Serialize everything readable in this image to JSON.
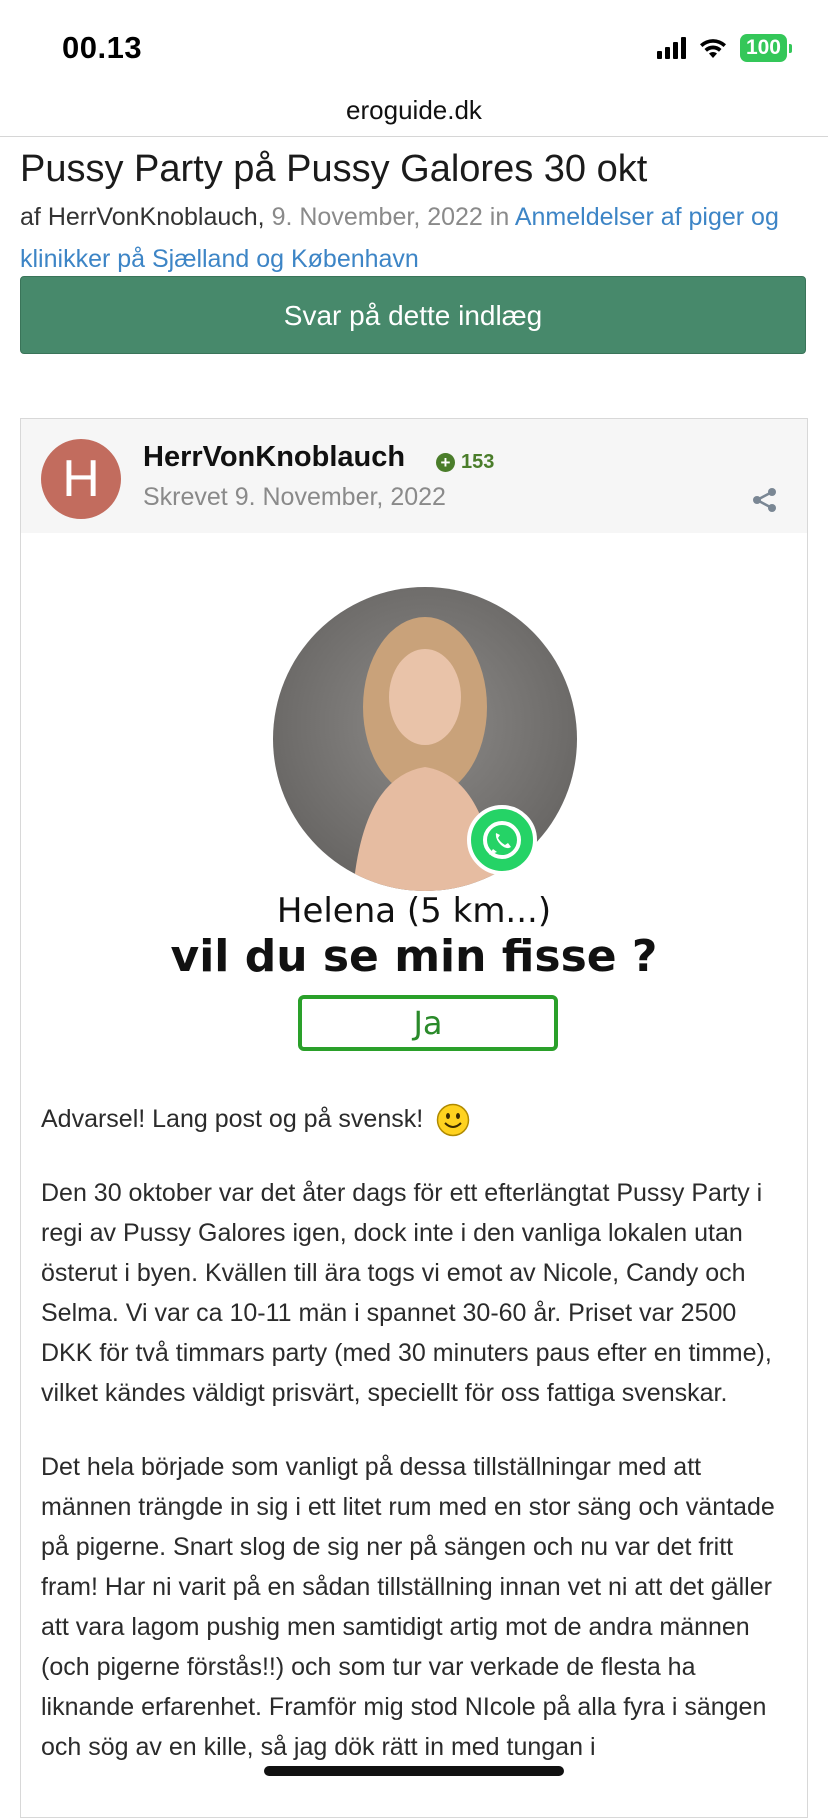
{
  "status_bar": {
    "time": "00.13",
    "battery": "100"
  },
  "browser": {
    "url": "eroguide.dk"
  },
  "topic": {
    "title": "Pussy Party på Pussy Galores 30 okt",
    "by_prefix": "af",
    "author": "HerrVonKnoblauch,",
    "date": "9. November, 2022",
    "in_word": "in",
    "forum": "Anmeldelser af piger og klinikker på Sjælland og København"
  },
  "reply_button": "Svar på dette indlæg",
  "post": {
    "avatar_letter": "H",
    "author": "HerrVonKnoblauch",
    "reputation": "153",
    "posted": "Skrevet 9. November, 2022"
  },
  "ad": {
    "name": "Helena",
    "distance": "(5 km...)",
    "question": "vil du se min fisse ?",
    "button": "Ja"
  },
  "body": {
    "warning": "Advarsel! Lang post og på svensk!",
    "paragraph1": "Den 30 oktober var det åter dags för ett efterlängtat Pussy Party i regi av Pussy Galores igen, dock inte i den vanliga lokalen utan österut i byen. Kvällen till ära togs vi emot av Nicole, Candy och Selma. Vi var ca 10-11 män i spannet 30-60 år. Priset var 2500 DKK för två timmars party (med 30 minuters paus efter en timme), vilket kändes väldigt prisvärt, speciellt för oss fattiga svenskar.",
    "paragraph2": "Det hela började som vanligt på dessa tillställningar med att männen trängde in sig i ett litet rum med en stor säng och väntade på pigerne. Snart slog de sig ner på sängen och nu var det fritt fram! Har ni varit på en sådan tillställning innan vet ni att det gäller att vara lagom pushig men samtidigt artig mot de andra männen (och pigerne förstås!!) och som tur var verkade de flesta ha liknande erfarenhet. Framför mig stod NIcole på alla fyra i sängen och sög av en kille, så jag dök rätt in med tungan i"
  }
}
